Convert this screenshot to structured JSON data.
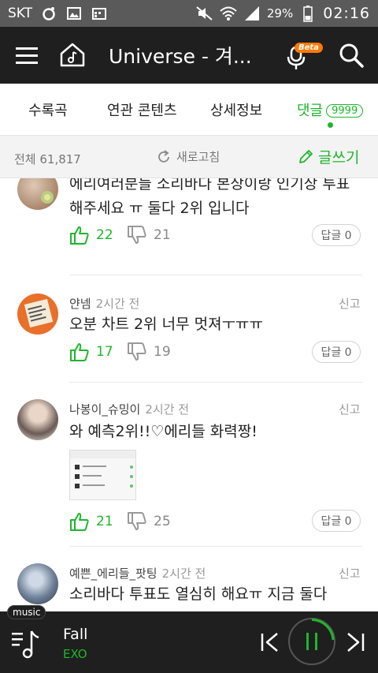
{
  "status": {
    "carrier": "SKT",
    "battery": "29%",
    "time": "02:16"
  },
  "header": {
    "title": "Universe - 겨...",
    "beta_badge": "Beta"
  },
  "tabs": [
    {
      "label": "수록곡"
    },
    {
      "label": "연관 콘텐츠"
    },
    {
      "label": "상세정보"
    },
    {
      "label": "댓글",
      "count": "9999",
      "active": true
    }
  ],
  "info": {
    "total": "전체 61,817",
    "refresh": "새로고침",
    "write": "글쓰기"
  },
  "comments": [
    {
      "text": "에리여러분들 소리바다 본상이랑 인기상 투표해주세요 ㅠ 둘다 2위 입니다",
      "likes": "22",
      "dislikes": "21",
      "reply": "답글 0"
    },
    {
      "author": "얀넴",
      "time": "2시간 전",
      "report": "신고",
      "text": "오분 차트 2위 너무 멋져ㅜㅠㅠ",
      "likes": "17",
      "dislikes": "19",
      "reply": "답글 0"
    },
    {
      "author": "나봉이_슈밍이",
      "time": "2시간 전",
      "report": "신고",
      "text": "와 예측2위!!♡에리들 화력짱!",
      "likes": "21",
      "dislikes": "25",
      "reply": "답글 0"
    },
    {
      "author": "예쁜_에리들_팟팅",
      "time": "2시간 전",
      "report": "신고",
      "text": "소리바다 투표도 열심히 해요ㅠ 지금 둘다"
    }
  ],
  "player": {
    "tag": "music",
    "title": "Fall",
    "artist": "EXO"
  },
  "colors": {
    "accent": "#1fb62c",
    "header_bg": "#1f1f1f",
    "status_bg": "#5a5a5a"
  }
}
